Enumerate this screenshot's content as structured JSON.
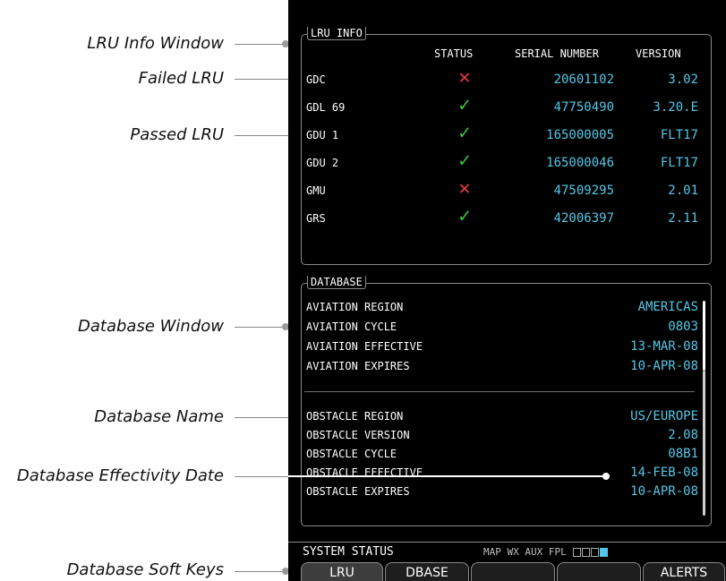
{
  "callouts": {
    "lru_info_window": "LRU Info Window",
    "failed_lru": "Failed LRU",
    "passed_lru": "Passed LRU",
    "database_window": "Database Window",
    "database_name": "Database Name",
    "database_effectivity_date": "Database Effectivity Date",
    "database_soft_keys": "Database Soft Keys"
  },
  "lru_info": {
    "title": "LRU INFO",
    "headers": {
      "status": "STATUS",
      "serial": "SERIAL NUMBER",
      "version": "VERSION"
    },
    "rows": [
      {
        "name": "GDC",
        "status": "failed",
        "icon": "✕",
        "serial": "20601102",
        "version": "3.02"
      },
      {
        "name": "GDL 69",
        "status": "passed",
        "icon": "✓",
        "serial": "47750490",
        "version": "3.20.E"
      },
      {
        "name": "GDU 1",
        "status": "passed",
        "icon": "✓",
        "serial": "165000005",
        "version": "FLT17"
      },
      {
        "name": "GDU 2",
        "status": "passed",
        "icon": "✓",
        "serial": "165000046",
        "version": "FLT17"
      },
      {
        "name": "GMU",
        "status": "failed",
        "icon": "✕",
        "serial": "47509295",
        "version": "2.01"
      },
      {
        "name": "GRS",
        "status": "passed",
        "icon": "✓",
        "serial": "42006397",
        "version": "2.11"
      }
    ]
  },
  "database": {
    "title": "DATABASE",
    "aviation": [
      {
        "label": "AVIATION REGION",
        "value": "AMERICAS"
      },
      {
        "label": "AVIATION CYCLE",
        "value": "0803"
      },
      {
        "label": "AVIATION EFFECTIVE",
        "value": "13-MAR-08"
      },
      {
        "label": "AVIATION EXPIRES",
        "value": "10-APR-08"
      }
    ],
    "obstacle": [
      {
        "label": "OBSTACLE REGION",
        "value": "US/EUROPE"
      },
      {
        "label": "OBSTACLE VERSION",
        "value": "2.08"
      },
      {
        "label": "OBSTACLE CYCLE",
        "value": "08B1"
      },
      {
        "label": "OBSTACLE EFFECTIVE",
        "value": "14-FEB-08"
      },
      {
        "label": "OBSTACLE EXPIRES",
        "value": "10-APR-08"
      }
    ]
  },
  "status_bar": {
    "page_name": "SYSTEM STATUS",
    "page_groups": "MAP WX AUX FPL"
  },
  "softkeys": [
    "LRU",
    "DBASE",
    "",
    "",
    "ALERTS"
  ],
  "colors": {
    "value_cyan": "#55c7e6",
    "fail_red": "#e53a3a",
    "pass_green": "#3fc43f"
  }
}
